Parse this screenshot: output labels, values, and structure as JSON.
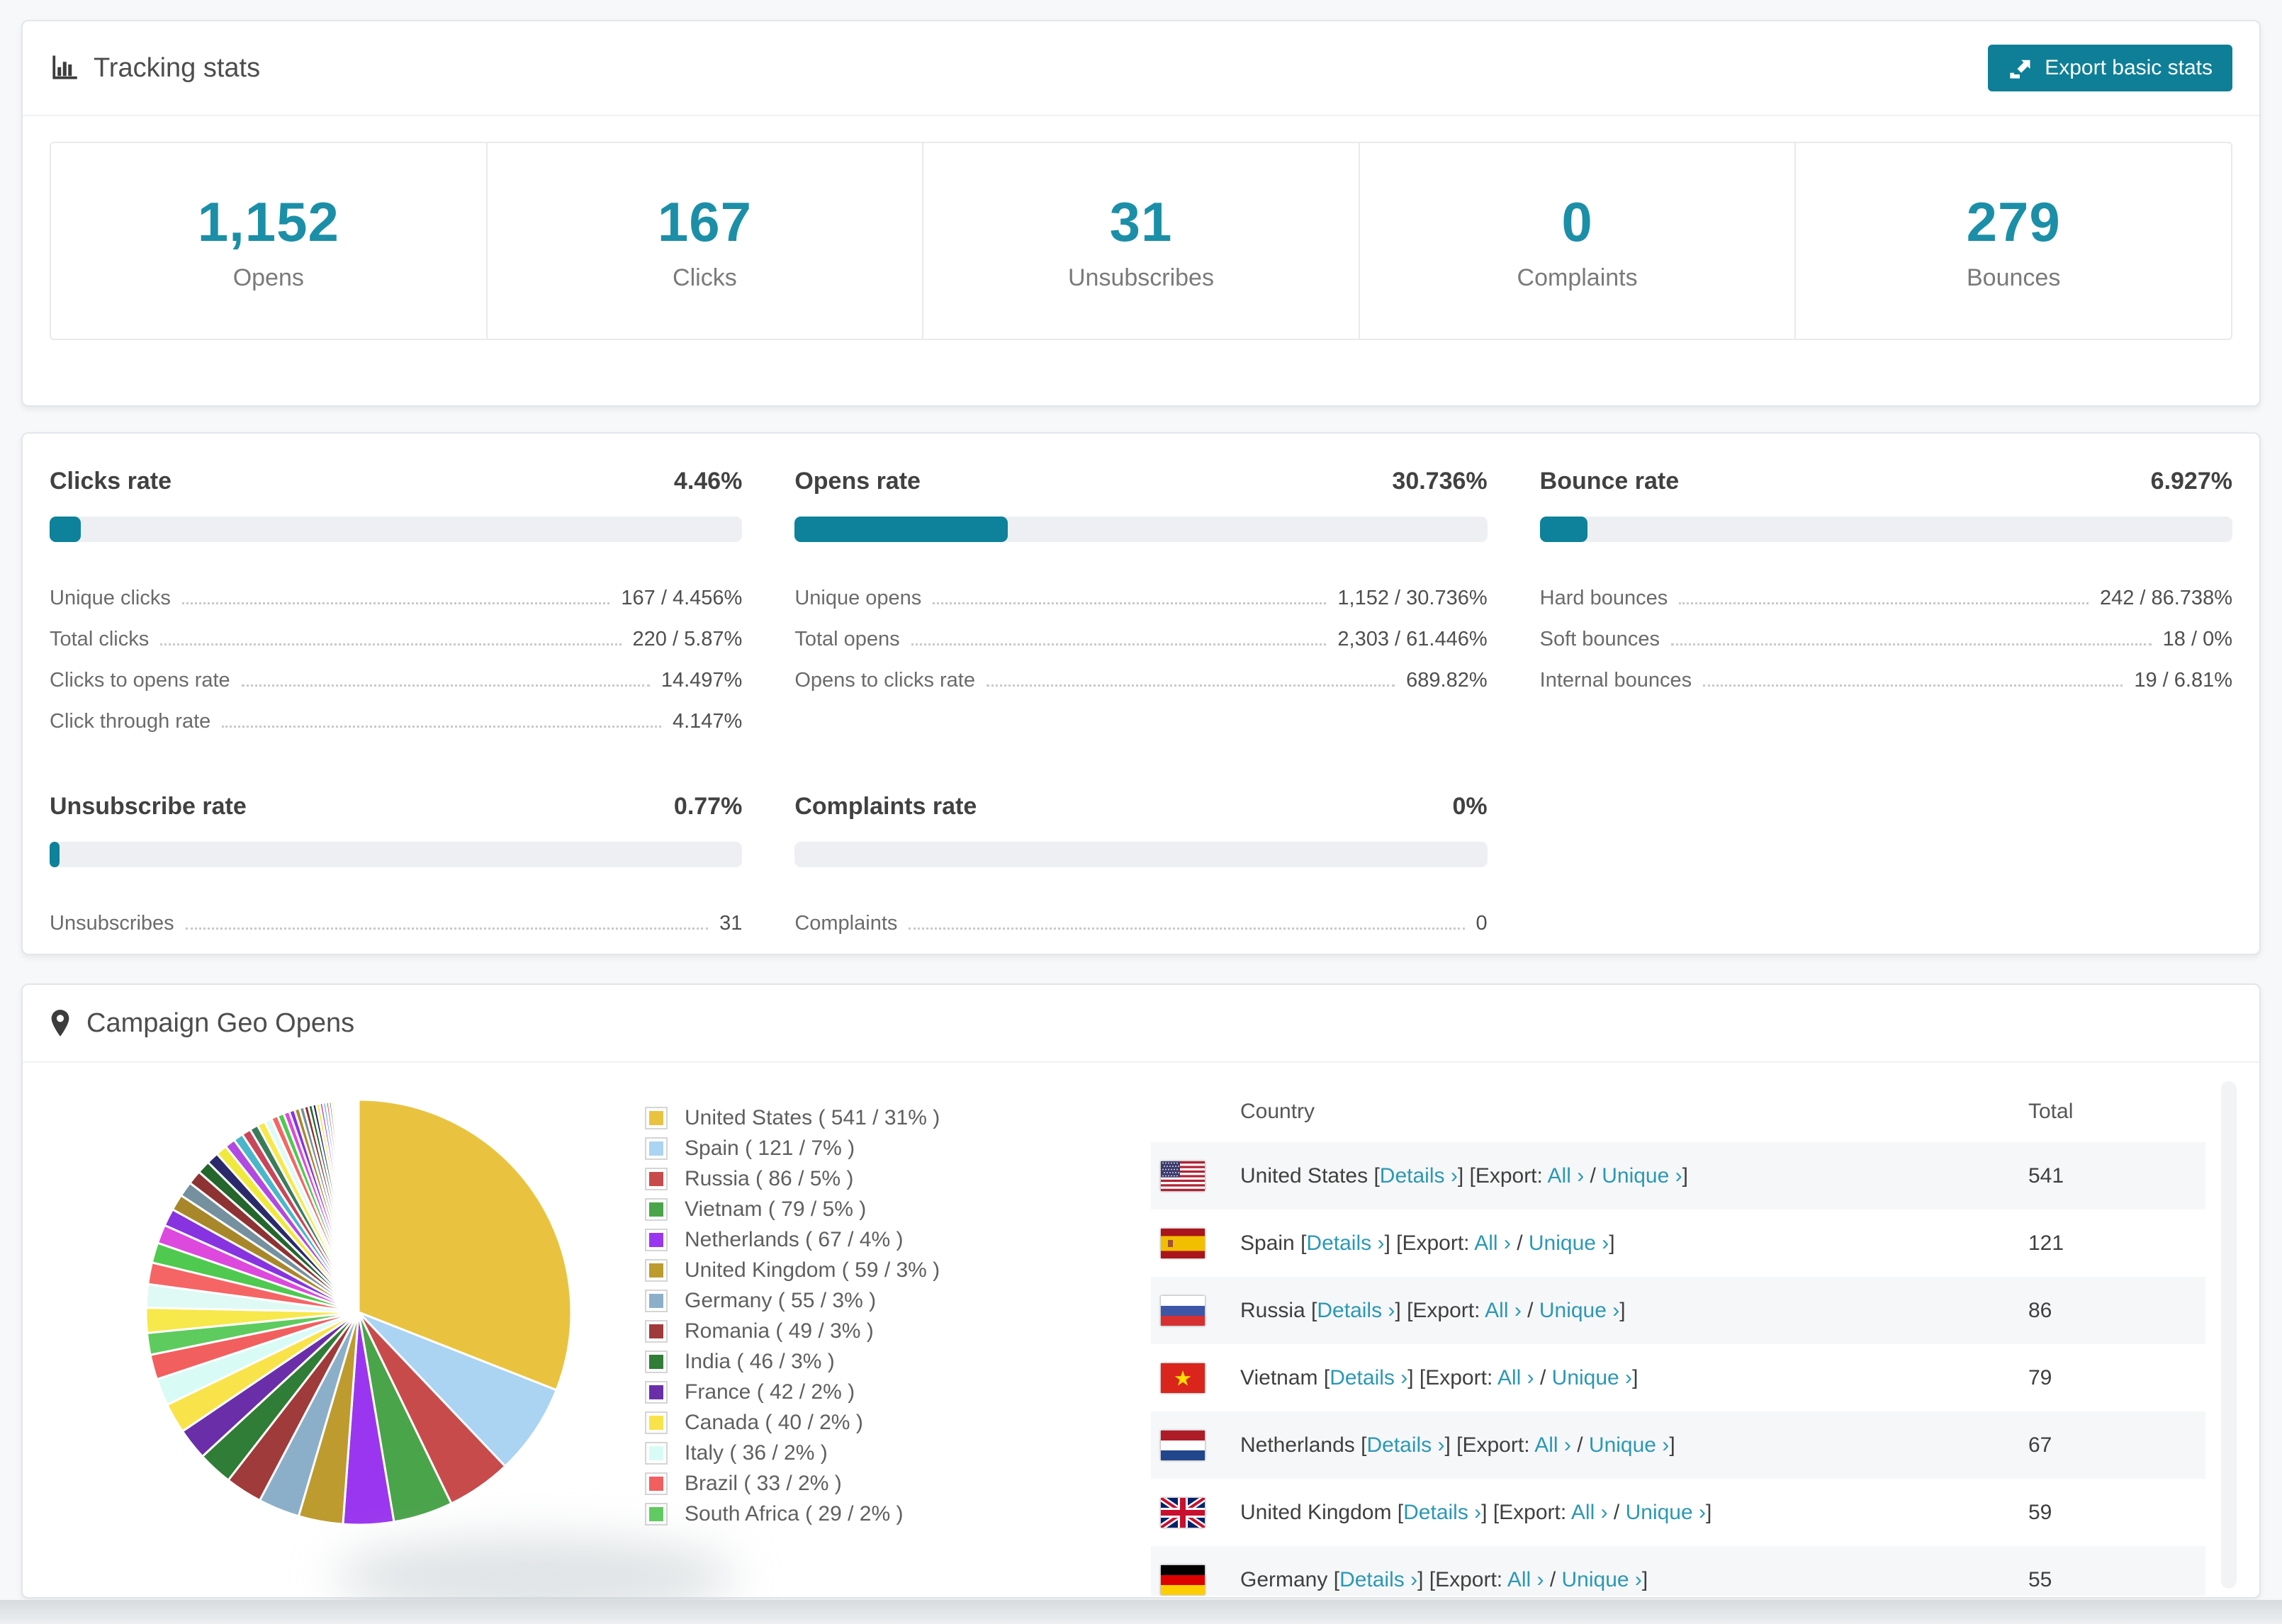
{
  "colors": {
    "accent_button": "#0e7f96",
    "accent_number": "#1b8fa7",
    "accent_bar": "#0e829a",
    "link": "#2b98b4",
    "bar_track": "#edeff2",
    "page_bg": "#f7f8f9"
  },
  "tracking": {
    "title": "Tracking stats",
    "export_button": "Export basic stats",
    "stats": [
      {
        "value": "1,152",
        "label": "Opens"
      },
      {
        "value": "167",
        "label": "Clicks"
      },
      {
        "value": "31",
        "label": "Unsubscribes"
      },
      {
        "value": "0",
        "label": "Complaints"
      },
      {
        "value": "279",
        "label": "Bounces"
      }
    ]
  },
  "rates": {
    "blocks": [
      {
        "title": "Clicks rate",
        "value": "4.46%",
        "percent": 4.46,
        "rows": [
          {
            "label": "Unique clicks",
            "value": "167 / 4.456%"
          },
          {
            "label": "Total clicks",
            "value": "220 / 5.87%"
          },
          {
            "label": "Clicks to opens rate",
            "value": "14.497%"
          },
          {
            "label": "Click through rate",
            "value": "4.147%"
          }
        ]
      },
      {
        "title": "Opens rate",
        "value": "30.736%",
        "percent": 30.736,
        "rows": [
          {
            "label": "Unique opens",
            "value": "1,152 / 30.736%"
          },
          {
            "label": "Total opens",
            "value": "2,303 / 61.446%"
          },
          {
            "label": "Opens to clicks rate",
            "value": "689.82%"
          }
        ]
      },
      {
        "title": "Bounce rate",
        "value": "6.927%",
        "percent": 6.927,
        "rows": [
          {
            "label": "Hard bounces",
            "value": "242 / 86.738%"
          },
          {
            "label": "Soft bounces",
            "value": "18 / 0%"
          },
          {
            "label": "Internal bounces",
            "value": "19 / 6.81%"
          }
        ]
      },
      {
        "title": "Unsubscribe rate",
        "value": "0.77%",
        "percent": 0.77,
        "rows": [
          {
            "label": "Unsubscribes",
            "value": "31"
          }
        ]
      },
      {
        "title": "Complaints rate",
        "value": "0%",
        "percent": 0,
        "rows": [
          {
            "label": "Complaints",
            "value": "0"
          }
        ]
      }
    ]
  },
  "geo": {
    "title": "Campaign Geo Opens",
    "legend_format": {
      "open": "( ",
      "separator": " / ",
      "close": " )"
    },
    "table": {
      "headers": {
        "country": "Country",
        "total": "Total"
      },
      "link_labels": {
        "details": "Details ›",
        "export_word": "Export:",
        "all": "All ›",
        "unique": "Unique ›",
        "bracket_open": "[",
        "bracket_close": "]",
        "slash": "/"
      },
      "rows": [
        {
          "country": "United States",
          "flag": "us",
          "total": "541"
        },
        {
          "country": "Spain",
          "flag": "es",
          "total": "121"
        },
        {
          "country": "Russia",
          "flag": "ru",
          "total": "86"
        },
        {
          "country": "Vietnam",
          "flag": "vn",
          "total": "79"
        },
        {
          "country": "Netherlands",
          "flag": "nl",
          "total": "67"
        },
        {
          "country": "United Kingdom",
          "flag": "gb",
          "total": "59"
        },
        {
          "country": "Germany",
          "flag": "de",
          "total": "55"
        }
      ]
    },
    "chart_data": {
      "type": "pie",
      "title": "Campaign Geo Opens",
      "legend_position": "right",
      "series": [
        {
          "name": "United States",
          "value": 541,
          "pct": "31%",
          "color": "#e9c340"
        },
        {
          "name": "Spain",
          "value": 121,
          "pct": "7%",
          "color": "#abd3f2"
        },
        {
          "name": "Russia",
          "value": 86,
          "pct": "5%",
          "color": "#c84b4b"
        },
        {
          "name": "Vietnam",
          "value": 79,
          "pct": "5%",
          "color": "#4aa44a"
        },
        {
          "name": "Netherlands",
          "value": 67,
          "pct": "4%",
          "color": "#9b36f0"
        },
        {
          "name": "United Kingdom",
          "value": 59,
          "pct": "3%",
          "color": "#bd9b2e"
        },
        {
          "name": "Germany",
          "value": 55,
          "pct": "3%",
          "color": "#8cafc9"
        },
        {
          "name": "Romania",
          "value": 49,
          "pct": "3%",
          "color": "#a03b3b"
        },
        {
          "name": "India",
          "value": 46,
          "pct": "3%",
          "color": "#2f7d36"
        },
        {
          "name": "France",
          "value": 42,
          "pct": "2%",
          "color": "#6a2fa8"
        },
        {
          "name": "Canada",
          "value": 40,
          "pct": "2%",
          "color": "#f8e34b"
        },
        {
          "name": "Italy",
          "value": 36,
          "pct": "2%",
          "color": "#d9fbf5"
        },
        {
          "name": "Brazil",
          "value": 33,
          "pct": "2%",
          "color": "#f15f5f"
        },
        {
          "name": "South Africa",
          "value": 29,
          "pct": "2%",
          "color": "#5ecb5e"
        }
      ],
      "others": {
        "value": 464,
        "note": "long tail of many small unlabeled slices, values estimated from pie"
      }
    }
  }
}
